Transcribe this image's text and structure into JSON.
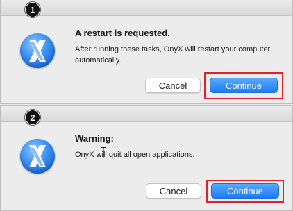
{
  "dialogs": [
    {
      "step": "1",
      "title": "A restart is requested.",
      "message": "After running these tasks, OnyX will restart your computer automatically.",
      "cancel_label": "Cancel",
      "continue_label": "Continue"
    },
    {
      "step": "2",
      "title": "Warning:",
      "message": "OnyX will quit all open applications.",
      "cancel_label": "Cancel",
      "continue_label": "Continue"
    }
  ],
  "app_icon": "onyx-x-icon",
  "colors": {
    "accent": "#1f7bf2",
    "highlight": "#e0202a"
  }
}
